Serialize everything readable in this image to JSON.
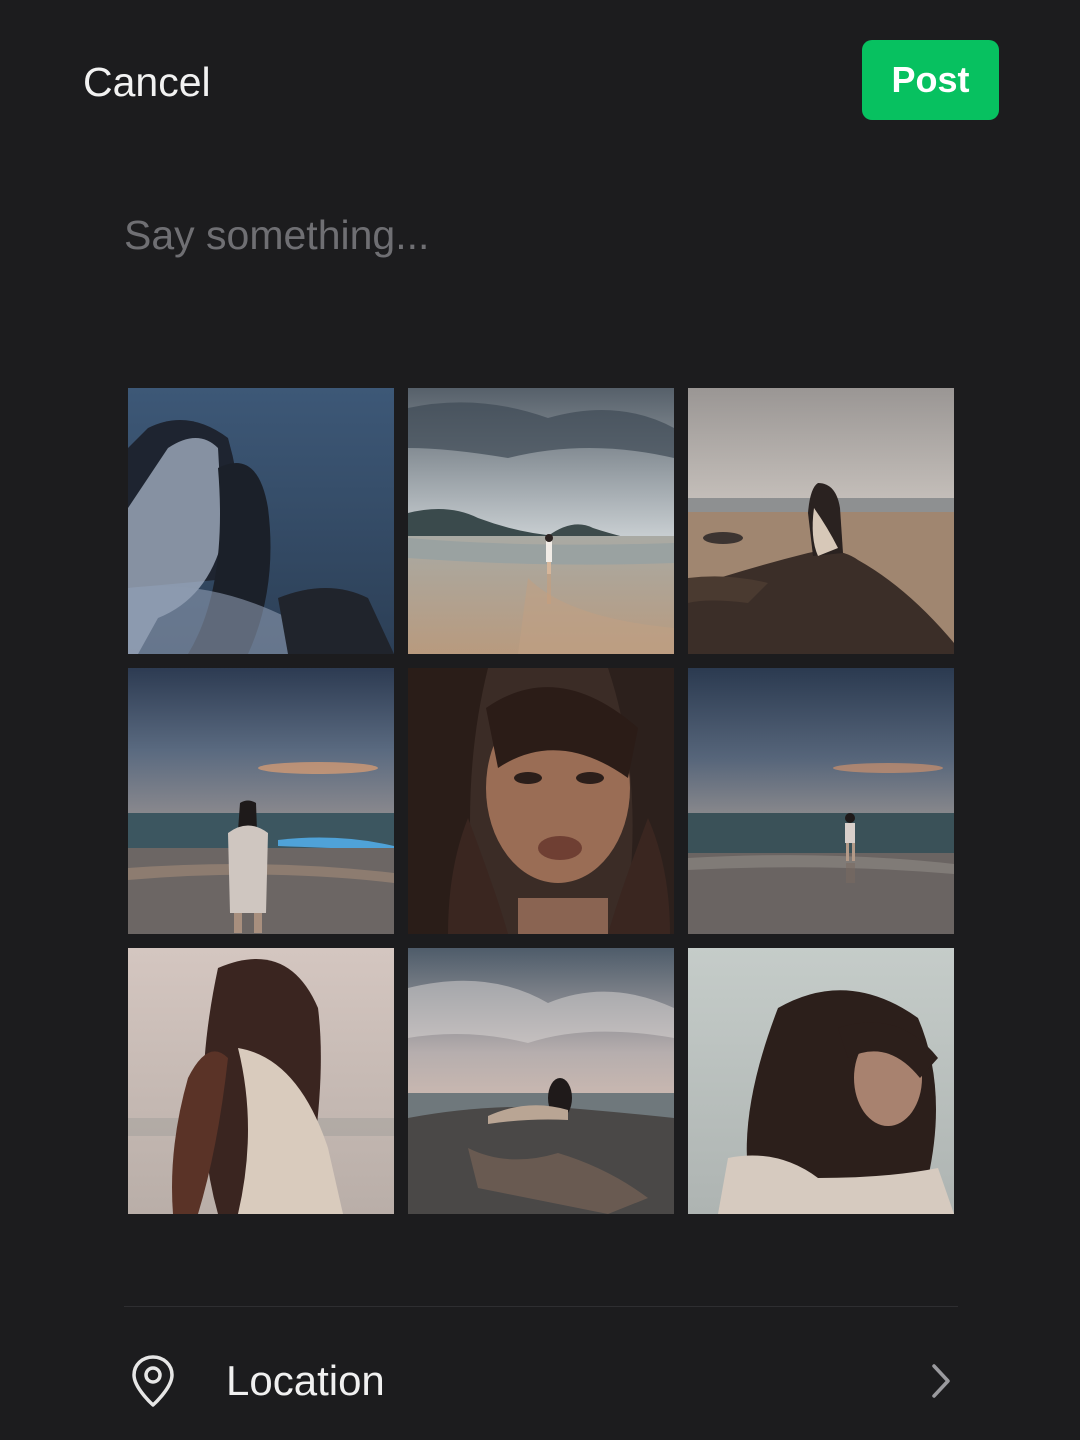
{
  "header": {
    "cancel_label": "Cancel",
    "post_label": "Post"
  },
  "composer": {
    "placeholder": "Say something...",
    "value": ""
  },
  "photos": [
    {
      "name": "photo-1",
      "icon": "blurred-portrait-hand-in-hair"
    },
    {
      "name": "photo-2",
      "icon": "beach-figure-far-shore"
    },
    {
      "name": "photo-3",
      "icon": "figure-sitting-on-rock"
    },
    {
      "name": "photo-4",
      "icon": "figure-standing-at-dusk-sea"
    },
    {
      "name": "photo-5",
      "icon": "close-up-face"
    },
    {
      "name": "photo-6",
      "icon": "figure-walking-at-shore"
    },
    {
      "name": "photo-7",
      "icon": "long-hair-looking-down"
    },
    {
      "name": "photo-8",
      "icon": "figure-lying-on-rock"
    },
    {
      "name": "photo-9",
      "icon": "windblown-hair-portrait"
    }
  ],
  "location": {
    "label": "Location",
    "icon": "map-pin-icon",
    "arrow_icon": "chevron-right-icon"
  },
  "colors": {
    "background": "#1c1c1e",
    "accent": "#07c160",
    "placeholder_text": "#6f6f73"
  }
}
